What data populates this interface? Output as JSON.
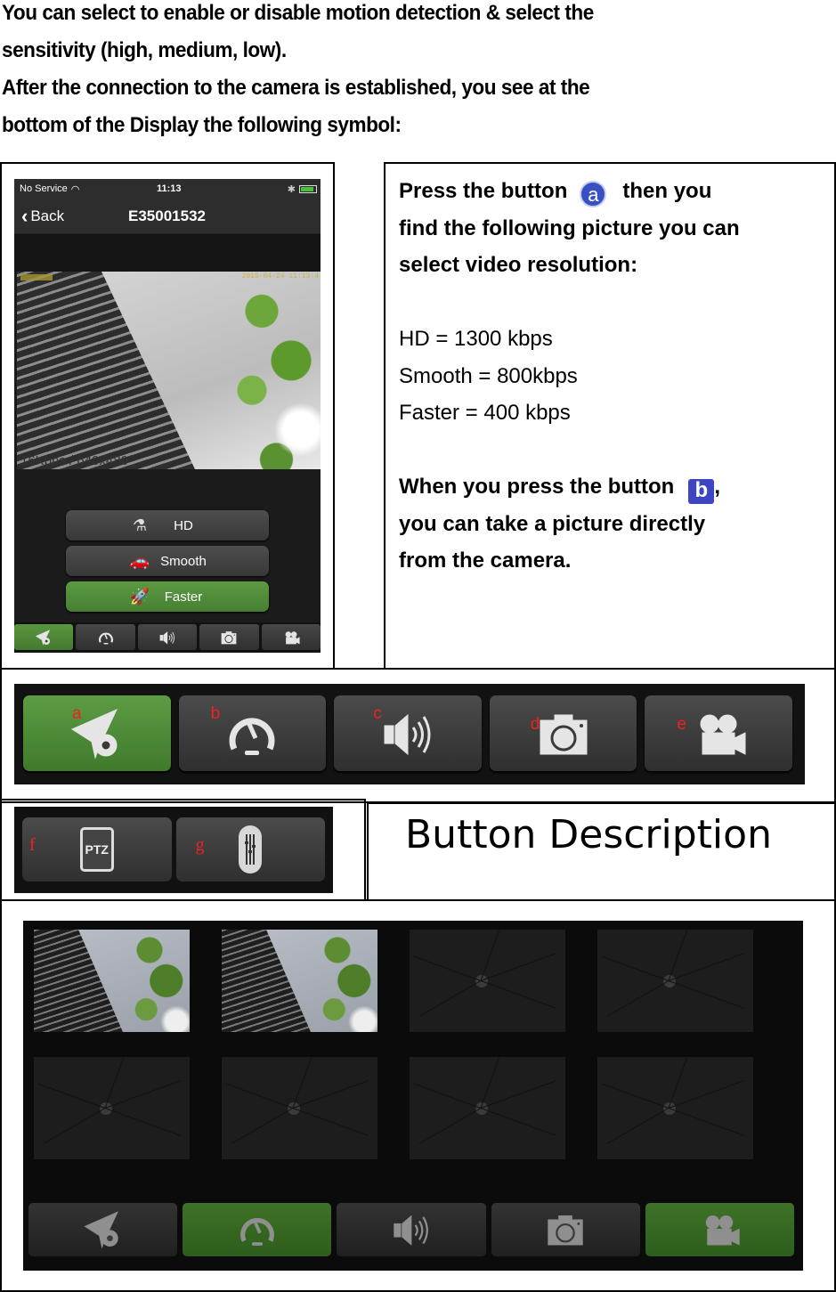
{
  "intro": {
    "lines": [
      "You can select to enable or disable motion detection & select the",
      "sensitivity (high, medium, low).",
      "After the connection to the camera is established, you see at the",
      "bottom of the Display the following symbol:"
    ]
  },
  "phone": {
    "status": {
      "carrier": "No Service",
      "time": "11:13"
    },
    "nav": {
      "back_label": "Back",
      "title": "E35001532"
    },
    "video": {
      "osd_timestamp": "2015-04-24 11:13:4",
      "bitrate_label": "16Kbps / 640x480"
    },
    "quality_options": [
      {
        "label": "HD",
        "icon": "microscope-icon",
        "glyph": "⚗",
        "active": false
      },
      {
        "label": "Smooth",
        "icon": "car-icon",
        "glyph": "🚗",
        "active": false
      },
      {
        "label": "Faster",
        "icon": "rocket-icon",
        "glyph": "🚀",
        "active": true
      }
    ],
    "tabs": [
      {
        "icon": "settings-icon",
        "active": true
      },
      {
        "icon": "speedometer-icon",
        "active": false
      },
      {
        "icon": "speaker-icon",
        "active": false
      },
      {
        "icon": "camera-icon",
        "active": false
      },
      {
        "icon": "video-camera-icon",
        "active": false
      }
    ]
  },
  "description": {
    "press_a_part1": "Press the button",
    "badge_a": "a",
    "press_a_part2": "then you",
    "press_a_line2": "find the following picture you can",
    "press_a_line3": "select video resolution:",
    "rates": [
      "HD = 1300 kbps",
      "Smooth = 800kbps",
      "Faster = 400 kbps"
    ],
    "press_b_part1": "When you press the button",
    "badge_b": "b",
    "press_b_comma": ",",
    "press_b_line2": "you can take a picture directly",
    "press_b_line3": "from the camera."
  },
  "toolbar_strip": {
    "buttons": [
      {
        "letter": "a",
        "icon": "settings-icon",
        "active": true
      },
      {
        "letter": "b",
        "icon": "speedometer-icon",
        "active": false
      },
      {
        "letter": "c",
        "icon": "speaker-icon",
        "active": false
      },
      {
        "letter": "d",
        "icon": "camera-icon",
        "active": false
      },
      {
        "letter": "e",
        "icon": "video-camera-icon",
        "active": false
      }
    ]
  },
  "toolbar_strip2": {
    "buttons": [
      {
        "letter": "f",
        "icon": "ptz-icon",
        "label": "PTZ"
      },
      {
        "letter": "g",
        "icon": "mixer-icon"
      }
    ]
  },
  "button_description_label": "Button Description",
  "gallery": {
    "thumbnails": [
      {
        "state": "captured"
      },
      {
        "state": "captured"
      },
      {
        "state": "empty"
      },
      {
        "state": "empty"
      },
      {
        "state": "empty"
      },
      {
        "state": "empty"
      },
      {
        "state": "empty"
      },
      {
        "state": "empty"
      }
    ],
    "tabs": [
      {
        "icon": "settings-icon",
        "active": false
      },
      {
        "icon": "speedometer-icon",
        "active": true
      },
      {
        "icon": "speaker-icon",
        "active": false
      },
      {
        "icon": "camera-icon",
        "active": false
      },
      {
        "icon": "video-camera-icon",
        "active": true
      }
    ]
  },
  "colors": {
    "active_green": "#4f8c38",
    "badge_blue": "#3a4fc4",
    "label_red": "#e22222"
  }
}
